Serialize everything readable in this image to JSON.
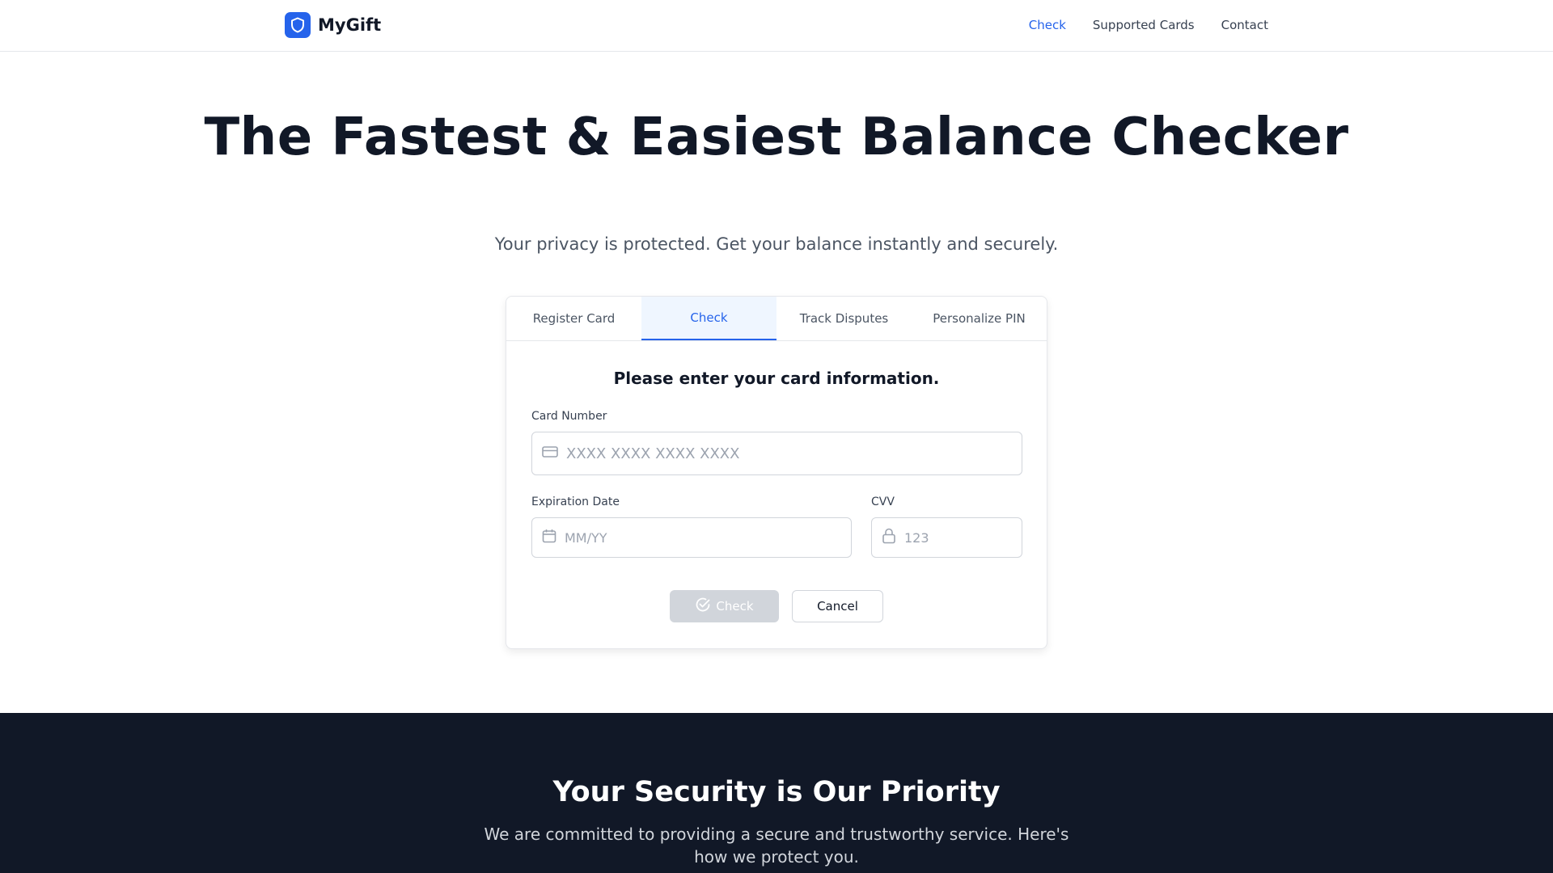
{
  "header": {
    "brand": "MyGift",
    "nav": [
      "Check",
      "Supported Cards",
      "Contact"
    ],
    "active_nav": "Check"
  },
  "hero": {
    "title": "The Fastest & Easiest Balance Checker",
    "subtitle": "Your privacy is protected. Get your balance instantly and securely."
  },
  "card": {
    "tabs": [
      "Register Card",
      "Check",
      "Track Disputes",
      "Personalize PIN"
    ],
    "active_tab": "Check",
    "heading": "Please enter your card information.",
    "card_number_label": "Card Number",
    "card_number_placeholder": "XXXX XXXX XXXX XXXX",
    "expiration_label": "Expiration Date",
    "expiration_placeholder": "MM/YY",
    "cvv_label": "CVV",
    "cvv_placeholder": "123",
    "check_button": "Check",
    "cancel_button": "Cancel"
  },
  "security": {
    "title": "Your Security is Our Priority",
    "text": "We are committed to providing a secure and trustworthy service. Here's how we protect you."
  },
  "icons": {
    "logo": "shield-icon",
    "card_number": "credit-card-icon",
    "expiration": "calendar-icon",
    "cvv": "lock-icon",
    "check_button": "check-circle-icon"
  },
  "colors": {
    "accent": "#2563eb",
    "dark": "#111827",
    "disabled_button": "#d1d5db"
  }
}
